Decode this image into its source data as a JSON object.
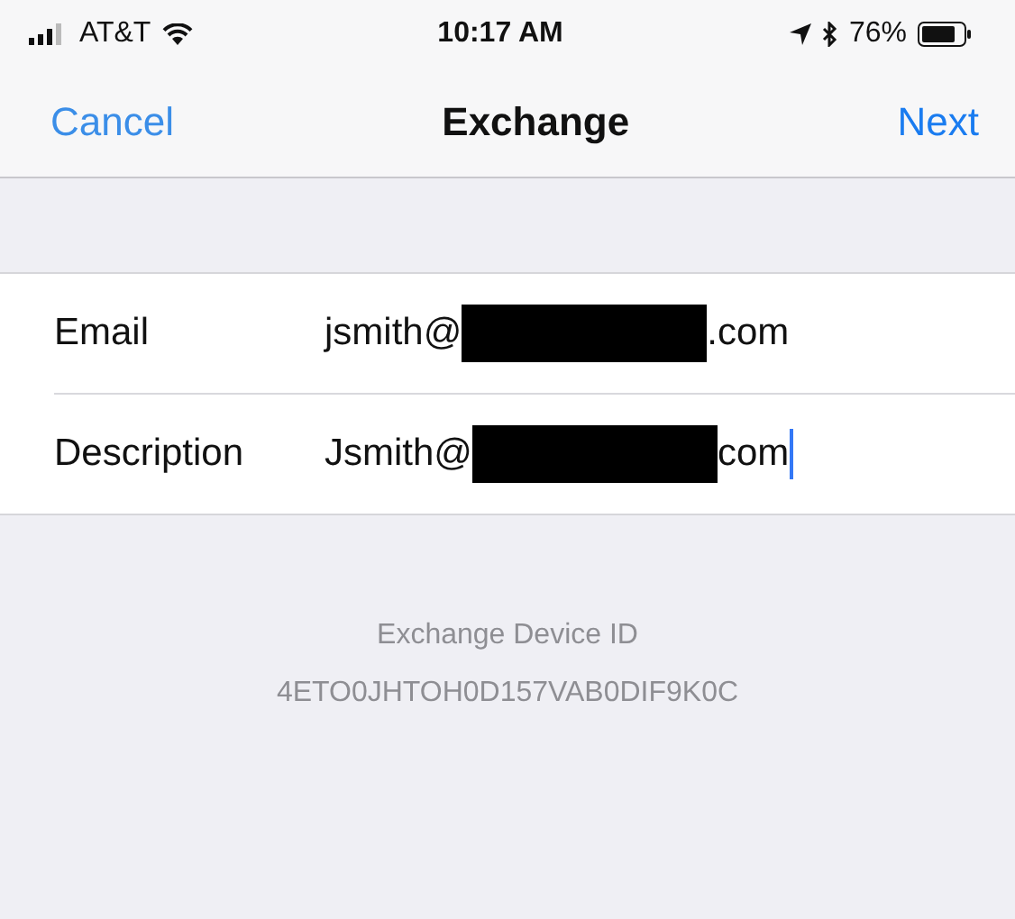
{
  "status_bar": {
    "carrier": "AT&T",
    "time": "10:17 AM",
    "battery_percent": "76%"
  },
  "nav_bar": {
    "left_button": "Cancel",
    "title": "Exchange",
    "right_button": "Next"
  },
  "fields": [
    {
      "label": "Email",
      "value_start": "jsmith@",
      "value_end": ".com",
      "redacted": true,
      "focused": false
    },
    {
      "label": "Description",
      "value_start": "Jsmith@",
      "value_end": "com",
      "redacted": true,
      "focused": true
    }
  ],
  "footer": {
    "title": "Exchange Device ID",
    "device_id": "4ETO0JHTOH0D157VAB0DIF9K0C"
  }
}
